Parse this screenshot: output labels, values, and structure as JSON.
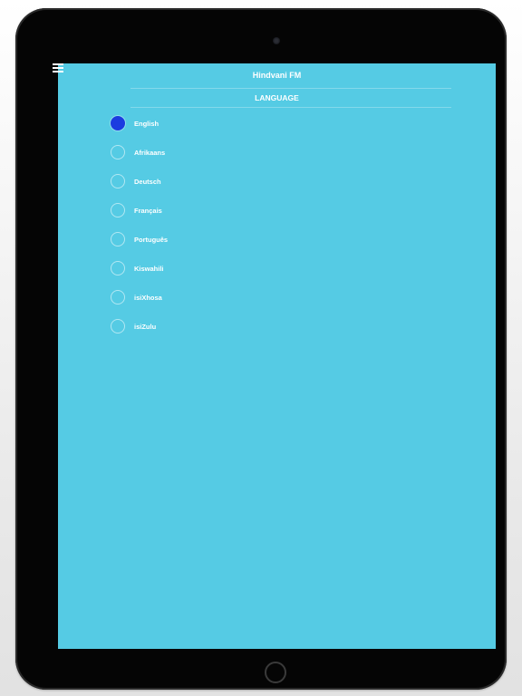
{
  "app": {
    "title": "Hindvani FM"
  },
  "section": {
    "title": "LANGUAGE"
  },
  "theme": {
    "background": "#55cbe4",
    "selected_radio": "#1b3ce0",
    "text": "#ffffff"
  },
  "icons": {
    "menu": "hamburger-menu-icon"
  },
  "languages": [
    {
      "label": "English",
      "selected": true
    },
    {
      "label": "Afrikaans",
      "selected": false
    },
    {
      "label": "Deutsch",
      "selected": false
    },
    {
      "label": "Français",
      "selected": false
    },
    {
      "label": "Português",
      "selected": false
    },
    {
      "label": "Kiswahili",
      "selected": false
    },
    {
      "label": "isiXhosa",
      "selected": false
    },
    {
      "label": "isiZulu",
      "selected": false
    }
  ]
}
